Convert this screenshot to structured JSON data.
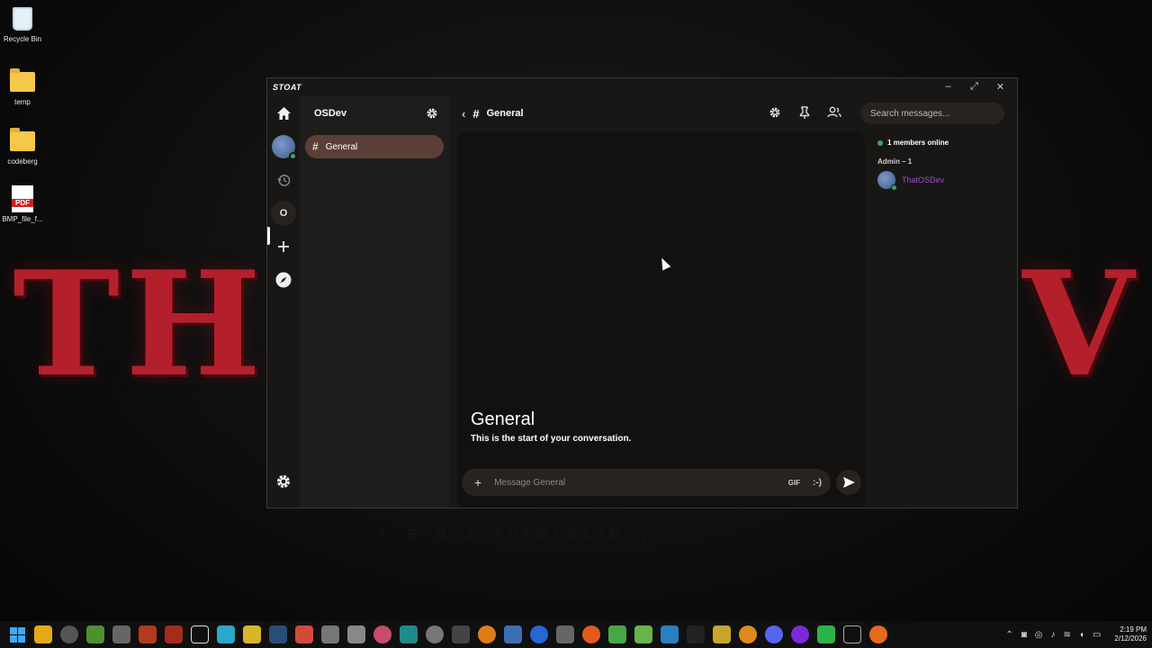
{
  "desktop": {
    "icons": [
      {
        "label": "Recycle Bin"
      },
      {
        "label": "temp"
      },
      {
        "label": "codeberg"
      },
      {
        "label": "BMP_file_f..."
      }
    ],
    "pdf_badge": "PDF",
    "wallpaper_left": "TH",
    "wallpaper_right": "V",
    "wallpaper_caption": "t a  a  i  totalsize  ,"
  },
  "app": {
    "brand": "STOAT",
    "window_controls": {
      "minimize": "–",
      "maximize": "⤢",
      "close": "✕"
    },
    "rail": {
      "server_initial": "O"
    },
    "server": {
      "name": "OSDev"
    },
    "channels": [
      {
        "label": "General"
      }
    ],
    "header": {
      "back": "‹",
      "hash": "#",
      "channel": "General",
      "search_placeholder": "Search messages..."
    },
    "chat": {
      "welcome_title": "General",
      "welcome_sub": "This is the start of your conversation.",
      "composer_placeholder": "Message General",
      "gif_label": "GIF",
      "emoji_label": ":-)"
    },
    "members": {
      "online_text": "1 members online",
      "role_header": "Admin – 1",
      "list": [
        {
          "name": "ThatOSDev"
        }
      ]
    }
  },
  "taskbar": {
    "time": "2:19 PM",
    "date": "2/12/2026"
  },
  "colors": {
    "accent_channel": "#5b3f37",
    "online_green": "#3ba55d",
    "member_name": "#a24ac9",
    "wallpaper_red": "#b3202c"
  }
}
